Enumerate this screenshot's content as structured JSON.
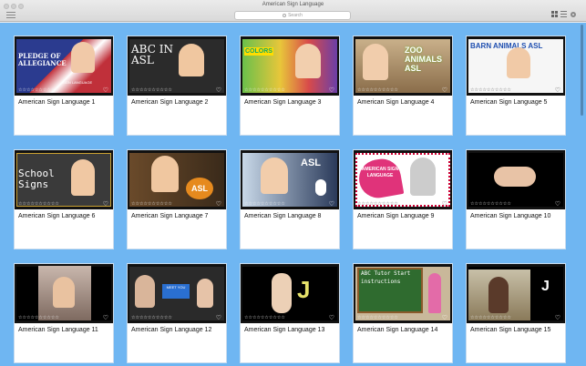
{
  "window": {
    "title": "American Sign Language"
  },
  "toolbar": {
    "search_placeholder": "Search"
  },
  "colors": {
    "content_background": "#6fb6f2",
    "card_background": "#ffffff"
  },
  "videos": [
    {
      "title": "American Sign Language  1",
      "rating": "☆☆☆☆☆☆☆☆☆☆",
      "thumbnail": "PLEDGE OF ALLEGIANCE",
      "sub_label": "SIGN LANGUAGE"
    },
    {
      "title": "American Sign Language  2",
      "rating": "☆☆☆☆☆☆☆☆☆☆",
      "thumbnail": "ABC IN ASL",
      "sub_label": ""
    },
    {
      "title": "American Sign Language  3",
      "rating": "☆☆☆☆☆☆☆☆☆☆",
      "thumbnail": "COLORS",
      "sub_label": ""
    },
    {
      "title": "American Sign Language  4",
      "rating": "☆☆☆☆☆☆☆☆☆☆",
      "thumbnail": "ZOO ANIMALS ASL",
      "sub_label": ""
    },
    {
      "title": "American Sign Language  5",
      "rating": "☆☆☆☆☆☆☆☆☆☆",
      "thumbnail": "BARN ANIMALS ASL",
      "sub_label": ""
    },
    {
      "title": "American Sign Language  6",
      "rating": "☆☆☆☆☆☆☆☆☆☆",
      "thumbnail": "School Signs",
      "sub_label": ""
    },
    {
      "title": "American Sign Language  7",
      "rating": "☆☆☆☆☆☆☆☆☆☆",
      "thumbnail": "ASL",
      "sub_label": ""
    },
    {
      "title": "American Sign Language  8",
      "rating": "☆☆☆☆☆☆☆☆☆☆",
      "thumbnail": "ASL",
      "sub_label": ""
    },
    {
      "title": "American Sign Language  9",
      "rating": "☆☆☆☆☆☆☆☆☆☆",
      "thumbnail": "AMERICAN SIGN LANGUAGE",
      "sub_label": ""
    },
    {
      "title": "American Sign Language  10",
      "rating": "☆☆☆☆☆☆☆☆☆☆",
      "thumbnail": "",
      "sub_label": ""
    },
    {
      "title": "American Sign Language  11",
      "rating": "☆☆☆☆☆☆☆☆☆☆",
      "thumbnail": "",
      "sub_label": ""
    },
    {
      "title": "American Sign Language  12",
      "rating": "☆☆☆☆☆☆☆☆☆☆",
      "thumbnail": "MEET YOU",
      "sub_label": ""
    },
    {
      "title": "American Sign Language  13",
      "rating": "☆☆☆☆☆☆☆☆☆☆",
      "thumbnail": "J",
      "sub_label": ""
    },
    {
      "title": "American Sign Language  14",
      "rating": "☆☆☆☆☆☆☆☆☆☆",
      "thumbnail": "ABC Tutor Start instructions",
      "sub_label": ""
    },
    {
      "title": "American Sign Language  15",
      "rating": "☆☆☆☆☆☆☆☆☆☆",
      "thumbnail": "J",
      "sub_label": ""
    }
  ]
}
